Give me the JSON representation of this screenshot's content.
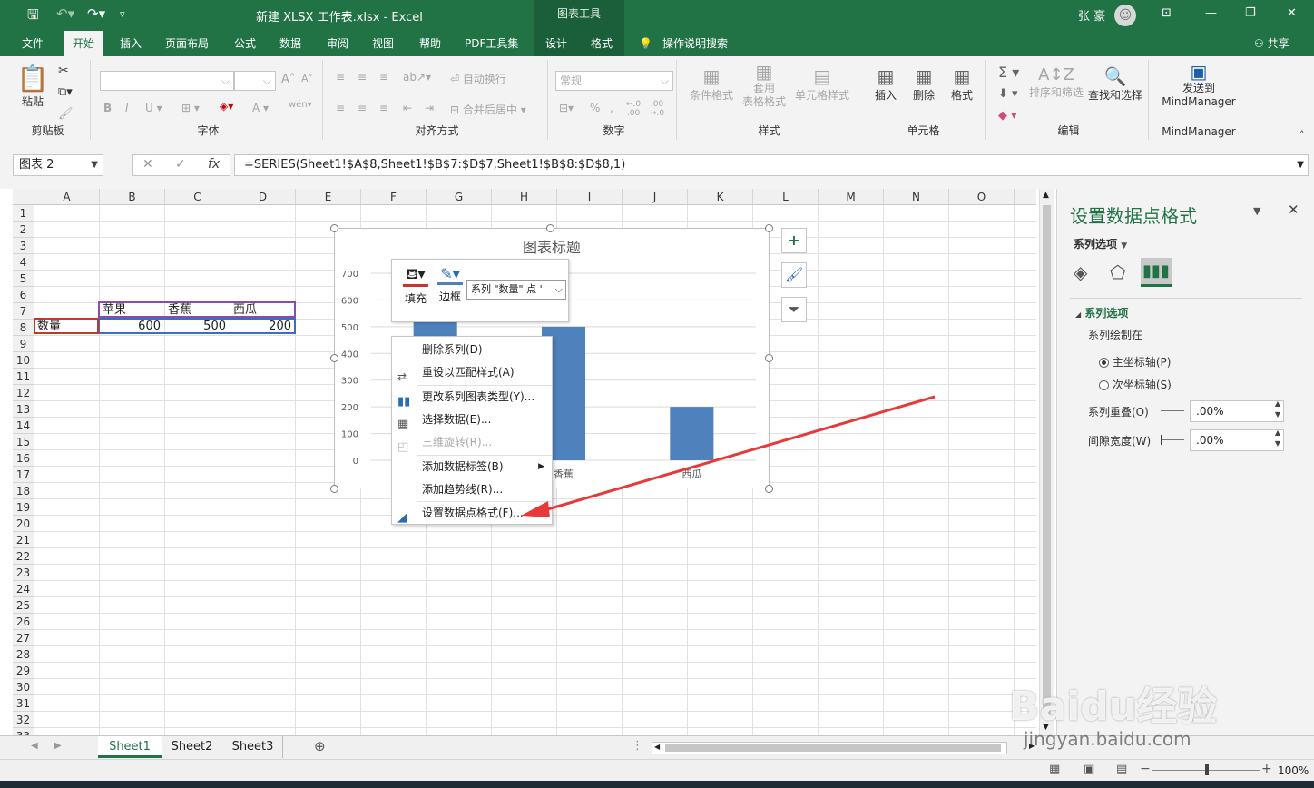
{
  "titlebar": {
    "doc_title": "新建 XLSX 工作表.xlsx  -  Excel",
    "chart_tools": "图表工具",
    "user_name": "张 豪"
  },
  "tabs": [
    "文件",
    "开始",
    "插入",
    "页面布局",
    "公式",
    "数据",
    "审阅",
    "视图",
    "帮助",
    "PDF工具集",
    "设计",
    "格式"
  ],
  "tell_me": "操作说明搜索",
  "share": "共享",
  "ribbon": {
    "clipboard": {
      "label": "剪贴板",
      "paste": "粘贴"
    },
    "font": {
      "label": "字体"
    },
    "alignment": {
      "label": "对齐方式",
      "wrap": "自动换行",
      "merge": "合并后居中"
    },
    "number": {
      "label": "数字",
      "format": "常规"
    },
    "styles": {
      "label": "样式",
      "conditional": "条件格式",
      "table": "套用\n表格格式",
      "cell": "单元格样式"
    },
    "cells": {
      "label": "单元格",
      "insert": "插入",
      "delete": "删除",
      "format": "格式"
    },
    "editing": {
      "label": "编辑",
      "sort": "排序和筛选",
      "find": "查找和选择"
    },
    "mindmanager": {
      "label": "MindManager",
      "send": "发送到\nMindManager"
    }
  },
  "formula_bar": {
    "name_box": "图表 2",
    "cancel": "✕",
    "enter": "✓",
    "fx": "fx",
    "formula": "=SERIES(Sheet1!$A$8,Sheet1!$B$7:$D$7,Sheet1!$B$8:$D$8,1)"
  },
  "columns": [
    "A",
    "B",
    "C",
    "D",
    "E",
    "F",
    "G",
    "H",
    "I",
    "J",
    "K",
    "L",
    "M",
    "N",
    "O"
  ],
  "rows": [
    "1",
    "2",
    "3",
    "4",
    "5",
    "6",
    "7",
    "8",
    "9",
    "10",
    "11",
    "12",
    "13",
    "14",
    "15",
    "16",
    "17",
    "18",
    "19",
    "20",
    "21",
    "22",
    "23",
    "24",
    "25",
    "26",
    "27",
    "28",
    "29",
    "30",
    "31",
    "32",
    "33"
  ],
  "cells": {
    "b7": "苹果",
    "c7": "香蕉",
    "d7": "西瓜",
    "a8": "数量",
    "b8": "600",
    "c8": "500",
    "d8": "200"
  },
  "chart_data": {
    "type": "bar",
    "title": "图表标题",
    "categories": [
      "苹果",
      "香蕉",
      "西瓜"
    ],
    "values": [
      600,
      500,
      200
    ],
    "ylim": [
      0,
      700
    ],
    "yticks": [
      "0",
      "100",
      "200",
      "300",
      "400",
      "500",
      "600",
      "700"
    ],
    "visible_category_labels": [
      "香蕉",
      "西瓜"
    ],
    "bar_color": "#4f81bd",
    "grid": true
  },
  "mini_toolbar": {
    "fill": "填充",
    "border": "边框",
    "series_select": "系列 \"数量\" 点 '"
  },
  "context_menu": [
    {
      "label": "删除系列(D)",
      "enabled": true
    },
    {
      "label": "重设以匹配样式(A)",
      "enabled": true
    },
    {
      "label": "更改系列图表类型(Y)...",
      "enabled": true
    },
    {
      "label": "选择数据(E)...",
      "enabled": true
    },
    {
      "label": "三维旋转(R)...",
      "enabled": false
    },
    {
      "label": "添加数据标签(B)",
      "enabled": true
    },
    {
      "label": "添加趋势线(R)...",
      "enabled": true
    },
    {
      "label": "设置数据点格式(F)...",
      "enabled": true
    }
  ],
  "pane": {
    "title": "设置数据点格式",
    "options_dropdown": "系列选项",
    "section": "系列选项",
    "plot_on": "系列绘制在",
    "primary_axis": "主坐标轴(P)",
    "secondary_axis": "次坐标轴(S)",
    "overlap_label": "系列重叠(O)",
    "overlap_value": ".00%",
    "gap_label": "间隙宽度(W)",
    "gap_value": ".00%"
  },
  "sheets": [
    "Sheet1",
    "Sheet2",
    "Sheet3"
  ],
  "status": {
    "zoom": "100%"
  },
  "watermark": {
    "brand": "Baidu经验",
    "url": "jingyan.baidu.com"
  },
  "colors": {
    "excel_green": "#217346",
    "accent_red": "#e8393a",
    "bar_blue": "#4f81bd"
  }
}
